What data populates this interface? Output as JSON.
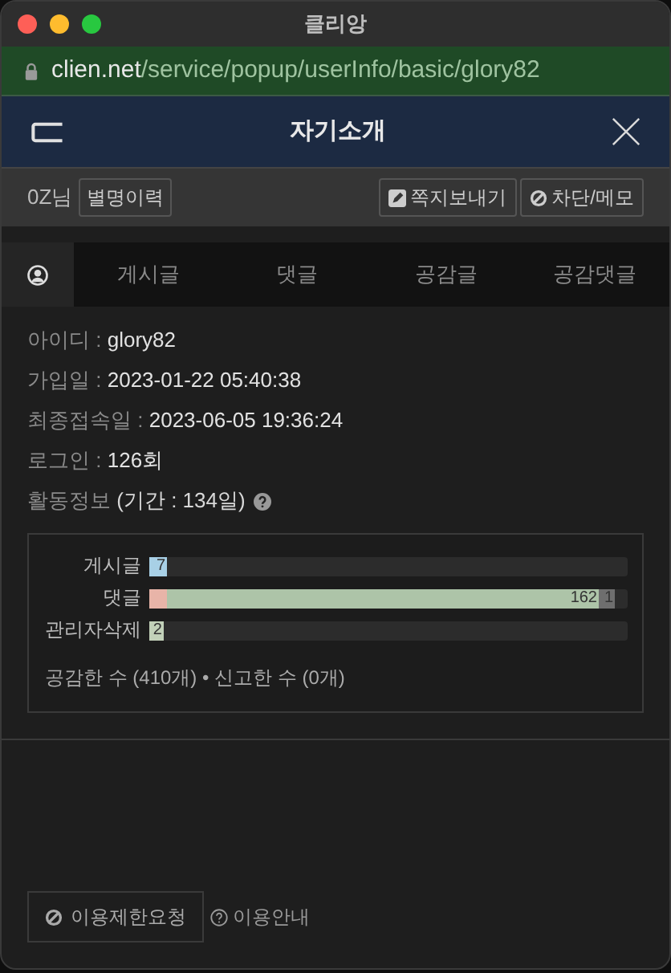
{
  "window": {
    "title": "클리앙"
  },
  "address_bar": {
    "domain": "clien.net",
    "path": "/service/popup/userInfo/basic/glory82"
  },
  "header": {
    "title": "자기소개"
  },
  "user": {
    "nickname": "0Z님",
    "history_button": "별명이력",
    "buttons": [
      {
        "kind": "message",
        "label": "쪽지보내기"
      },
      {
        "kind": "block",
        "label": "차단/메모"
      }
    ]
  },
  "tabs": [
    {
      "kind": "profile",
      "selected": true
    },
    {
      "kind": "text",
      "label": "게시글",
      "selected": false
    },
    {
      "kind": "text",
      "label": "댓글",
      "selected": false
    },
    {
      "kind": "text",
      "label": "공감글",
      "selected": false
    },
    {
      "kind": "text",
      "label": "공감댓글",
      "selected": false
    }
  ],
  "info": [
    {
      "label": "아이디 :",
      "value": "glory82"
    },
    {
      "label": "가입일 :",
      "value": "2023-01-22 05:40:38"
    },
    {
      "label": "최종접속일 :",
      "value": "2023-06-05 19:36:24"
    },
    {
      "label": "로그인 :",
      "value": "126회"
    }
  ],
  "activity": {
    "label": "활동정보",
    "period": "(기간 : 134일)"
  },
  "stats": [
    {
      "label": "게시글",
      "segments": [
        {
          "kind": "start",
          "value": "7",
          "level": 0.037,
          "color": "#a8d0e6"
        }
      ]
    },
    {
      "label": "댓글",
      "segments": [
        {
          "kind": "start",
          "level": 0.037,
          "color": "#e8b4a8"
        },
        {
          "kind": "fill",
          "value": "162",
          "color": "#adc4a8"
        },
        {
          "kind": "end",
          "value": "1",
          "color": "#6e6e6e"
        }
      ]
    },
    {
      "label": "관리자삭제",
      "segments": [
        {
          "kind": "start",
          "value": "2",
          "level": 0.03,
          "color": "#c2d1b9"
        }
      ]
    }
  ],
  "summary": "공감한 수 (410개) • 신고한 수 (0개)",
  "footer": {
    "report_button": "이용제한요청",
    "help_link": "이용안내"
  }
}
